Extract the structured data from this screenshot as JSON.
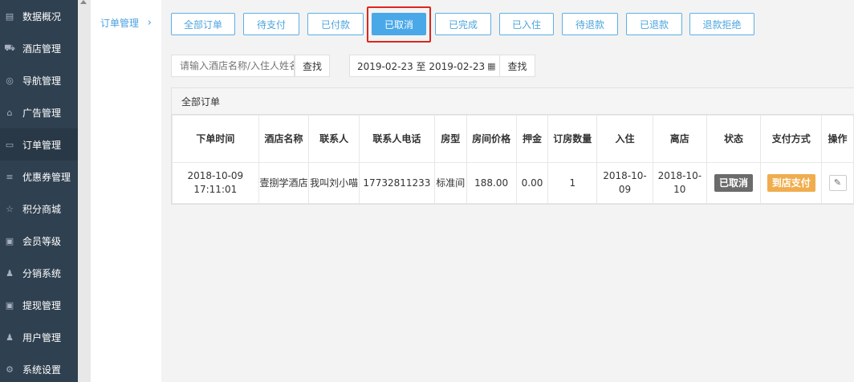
{
  "sidebar": {
    "items": [
      {
        "label": "数据概况",
        "icon": "dashboard-icon",
        "glyph": "▤"
      },
      {
        "label": "酒店管理",
        "icon": "cart-icon",
        "glyph": "⛟"
      },
      {
        "label": "导航管理",
        "icon": "compass-icon",
        "glyph": "◎"
      },
      {
        "label": "广告管理",
        "icon": "gift-icon",
        "glyph": "⌂"
      },
      {
        "label": "订单管理",
        "icon": "order-list-icon",
        "glyph": "▭"
      },
      {
        "label": "优惠券管理",
        "icon": "menu-icon",
        "glyph": "≡"
      },
      {
        "label": "积分商城",
        "icon": "star-icon",
        "glyph": "☆"
      },
      {
        "label": "会员等级",
        "icon": "money-icon",
        "glyph": "▣"
      },
      {
        "label": "分销系统",
        "icon": "users-icon",
        "glyph": "♟"
      },
      {
        "label": "提现管理",
        "icon": "cash-icon",
        "glyph": "▣"
      },
      {
        "label": "用户管理",
        "icon": "user-icon",
        "glyph": "♟"
      },
      {
        "label": "系统设置",
        "icon": "gear-icon",
        "glyph": "⚙"
      }
    ]
  },
  "subnav": {
    "label": "订单管理",
    "chevron": "›"
  },
  "tabs": [
    "全部订单",
    "待支付",
    "已付款",
    "已取消",
    "已完成",
    "已入住",
    "待退款",
    "已退款",
    "退款拒绝"
  ],
  "active_tab": "已取消",
  "search": {
    "placeholder": "请输入酒店名称/入住人姓名",
    "find_label": "查找"
  },
  "date_filter": {
    "value": "2019-02-23 至 2019-02-23",
    "find_label": "查找"
  },
  "panel": {
    "title": "全部订单",
    "columns": [
      "下单时间",
      "酒店名称",
      "联系人",
      "联系人电话",
      "房型",
      "房间价格",
      "押金",
      "订房数量",
      "入住",
      "离店",
      "状态",
      "支付方式",
      "操作"
    ],
    "rows": [
      {
        "order_time": "2018-10-09 17:11:01",
        "hotel": "壹捌学酒店",
        "contact": "我叫刘小喵",
        "phone": "17732811233",
        "room_type": "标准间",
        "price": "188.00",
        "deposit": "0.00",
        "quantity": "1",
        "checkin": "2018-10-09",
        "checkout": "2018-10-10",
        "status": "已取消",
        "payment": "到店支付"
      }
    ]
  },
  "colors": {
    "sidebar_bg": "#2f4050",
    "accent": "#4aa8e8",
    "status_gray": "#6b6b6b",
    "pay_orange": "#f0ad4e",
    "highlight_red": "#e0251b"
  }
}
